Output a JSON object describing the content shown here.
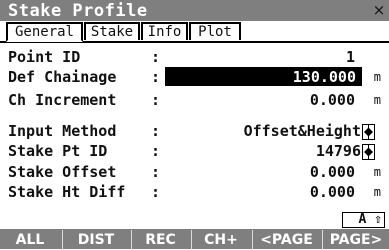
{
  "window": {
    "title": "Stake Profile",
    "close_glyph": "×"
  },
  "tabs": [
    "General",
    "Stake",
    "Info",
    "Plot"
  ],
  "fields": {
    "point_id": {
      "label": "Point ID",
      "value": "1"
    },
    "def_chainage": {
      "label": "Def Chainage",
      "value": "130.000",
      "unit": "m"
    },
    "ch_increment": {
      "label": "Ch Increment",
      "value": "0.000",
      "unit": "m"
    },
    "input_method": {
      "label": "Input Method",
      "value": "Offset&Height"
    },
    "stake_pt_id": {
      "label": "Stake Pt ID",
      "value": "14796"
    },
    "stake_offset": {
      "label": "Stake Offset",
      "value": "0.000",
      "unit": "m"
    },
    "stake_ht_diff": {
      "label": "Stake Ht Diff",
      "value": "0.000",
      "unit": "m"
    }
  },
  "status": {
    "indicator": "A ⇧"
  },
  "softkeys": [
    "ALL",
    "DIST",
    "REC",
    "CH+",
    "<PAGE",
    "PAGE>"
  ]
}
